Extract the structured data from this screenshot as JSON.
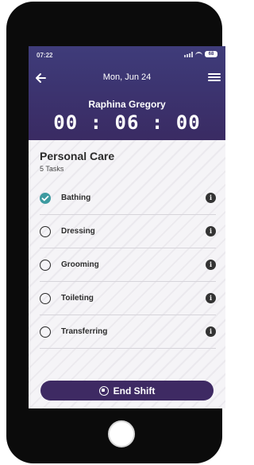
{
  "status_bar": {
    "time": "07:22",
    "battery": "68"
  },
  "header": {
    "date": "Mon, Jun 24",
    "client_name": "Raphina Gregory",
    "timer": "00 : 06 : 00"
  },
  "section": {
    "title": "Personal Care",
    "subtitle": "5 Tasks"
  },
  "tasks": [
    {
      "label": "Bathing",
      "checked": true
    },
    {
      "label": "Dressing",
      "checked": false
    },
    {
      "label": "Grooming",
      "checked": false
    },
    {
      "label": "Toileting",
      "checked": false
    },
    {
      "label": "Transferring",
      "checked": false
    }
  ],
  "actions": {
    "end_shift_label": "End Shift"
  },
  "colors": {
    "header": "#3c3470",
    "accent_check": "#3d9aa0",
    "primary_button": "#3e2a63"
  }
}
